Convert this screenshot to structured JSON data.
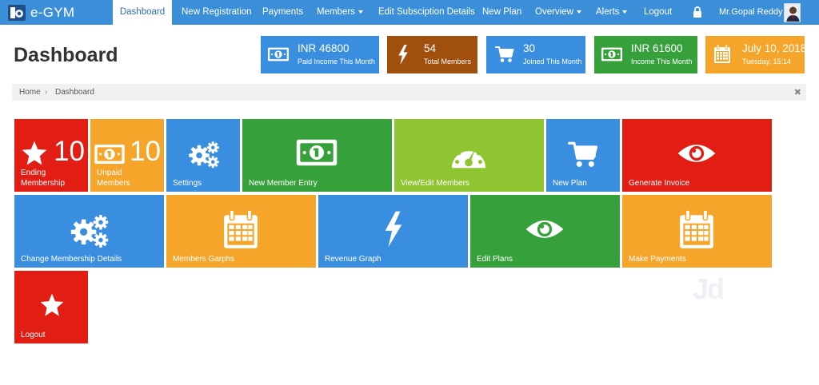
{
  "brand": {
    "name": "e-GYM",
    "logo_icon": "gym-logo-icon"
  },
  "nav": {
    "items": [
      {
        "label": "Dashboard",
        "active": true
      },
      {
        "label": "New Registration"
      },
      {
        "label": "Payments"
      },
      {
        "label": "Members",
        "dropdown": true
      },
      {
        "label": "Edit Subsciption Details"
      },
      {
        "label": "New Plan"
      },
      {
        "label": "Overview",
        "dropdown": true
      },
      {
        "label": "Alerts",
        "dropdown": true
      },
      {
        "label": "Logout"
      }
    ],
    "lock_icon": "lock-icon",
    "user_name": "Mr.Gopal Reddy",
    "avatar_icon": "user-avatar-icon"
  },
  "page_title": "Dashboard",
  "stats": [
    {
      "value": "INR 46800",
      "label": "Paid Income This Month",
      "icon": "money-icon",
      "color": "#3a8edf"
    },
    {
      "value": "54",
      "label": "Total Members",
      "icon": "bolt-icon",
      "color": "#a04f0c"
    },
    {
      "value": "30",
      "label": "Joined This Month",
      "icon": "cart-icon",
      "color": "#3a8edf"
    },
    {
      "value": "INR 61600",
      "label": "Income This Month",
      "icon": "money-icon",
      "color": "#36a13b"
    },
    {
      "value": "July 10, 2018",
      "label": "Tuesday, 15:14",
      "icon": "calendar-icon",
      "color": "#f6a52b"
    }
  ],
  "breadcrumb": {
    "home": "Home",
    "separator": "›",
    "current": "Dashboard",
    "close_icon": "close-icon"
  },
  "tiles": [
    {
      "label_1": "Ending",
      "label_2": "Membership",
      "count": "10",
      "icon": "star-icon",
      "color": "#e21d14"
    },
    {
      "label_1": "Unpaid",
      "label_2": "Members",
      "count": "10",
      "icon": "money-icon",
      "color": "#f6a52b"
    },
    {
      "label": "Settings",
      "icon": "gears-icon",
      "color": "#3a8edf"
    },
    {
      "label": "New Member Entry",
      "icon": "money-icon",
      "color": "#36a13b"
    },
    {
      "label": "View/Edit Members",
      "icon": "dashboard-gauge-icon",
      "color": "#8fc531"
    },
    {
      "label": "New Plan",
      "icon": "cart-icon",
      "color": "#3a8edf"
    },
    {
      "label": "Generate Invoice",
      "icon": "eye-icon",
      "color": "#e21d14"
    },
    {
      "label": "Change Membership Details",
      "icon": "gears-icon",
      "color": "#3a8edf"
    },
    {
      "label": "Members Garphs",
      "icon": "calendar-icon",
      "color": "#f6a52b"
    },
    {
      "label": "Revenue Graph",
      "icon": "bolt-icon",
      "color": "#3a8edf"
    },
    {
      "label": "Edit Plans",
      "icon": "eye-icon",
      "color": "#36a13b"
    },
    {
      "label": "Make Payments",
      "icon": "calendar-icon",
      "color": "#f6a52b"
    },
    {
      "label": "Logout",
      "icon": "star-icon",
      "color": "#e21d14"
    }
  ],
  "watermark": "Jd"
}
